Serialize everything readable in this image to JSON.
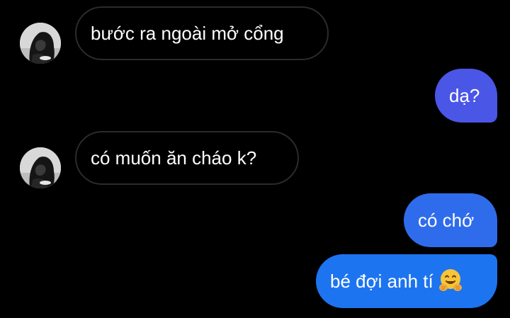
{
  "conversation": {
    "messages": [
      {
        "sender": "other",
        "text": "bước ra ngoài mở cổng"
      },
      {
        "sender": "me",
        "text": "dạ?"
      },
      {
        "sender": "other",
        "text": "có muốn ăn cháo k?"
      },
      {
        "sender": "me",
        "text": "có chớ"
      },
      {
        "sender": "me",
        "text": "bé đợi anh tí",
        "emoji": "hugging-face-icon"
      }
    ]
  },
  "colors": {
    "background": "#000000",
    "incoming_bubble_border": "#2b2b2b",
    "outgoing_bubble_top": "#4a56e6",
    "outgoing_bubble_mid": "#2f6cec",
    "outgoing_bubble_bottom": "#1d74f0",
    "text": "#ffffff"
  }
}
